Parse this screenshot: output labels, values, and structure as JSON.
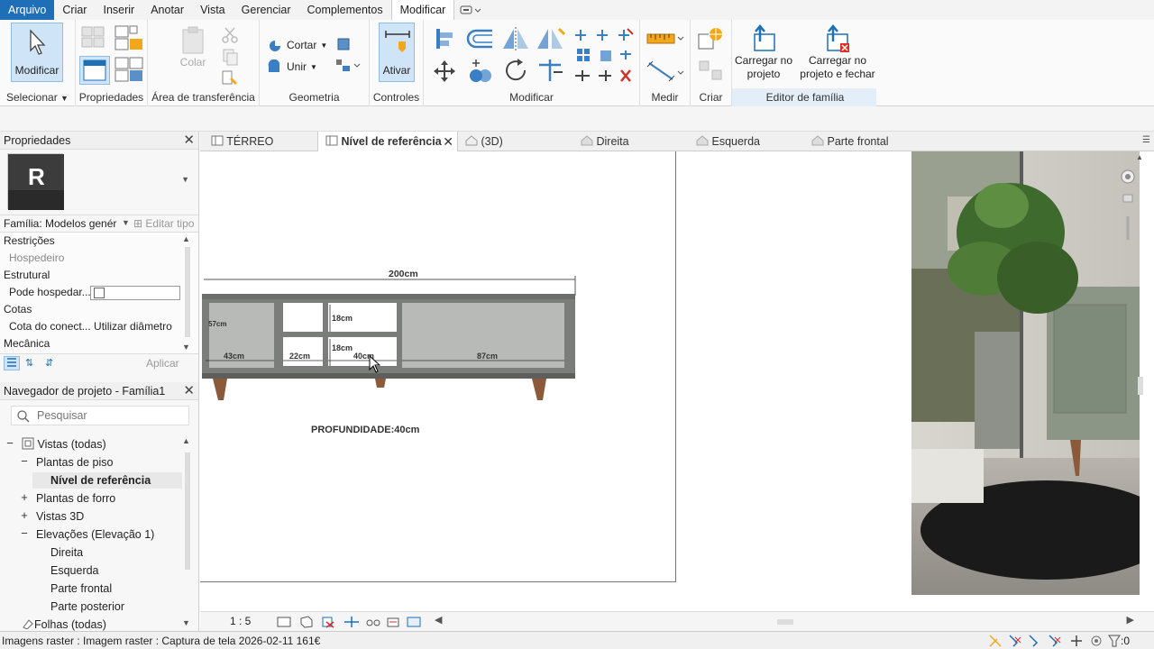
{
  "menu": {
    "items": [
      "Arquivo",
      "Criar",
      "Inserir",
      "Anotar",
      "Vista",
      "Gerenciar",
      "Complementos",
      "Modificar"
    ],
    "active": "Modificar"
  },
  "ribbon": {
    "modify_label": "Modificar",
    "select_label": "Selecionar",
    "properties_label": "Propriedades",
    "clipboard_label": "Área de transferência",
    "paste_label": "Colar",
    "cut_label": "Cortar",
    "join_label": "Unir",
    "geometry_label": "Geometria",
    "activate_label": "Ativar",
    "controls_label": "Controles",
    "modify_panel_label": "Modificar",
    "measure_label": "Medir",
    "create_label": "Criar",
    "load_project_line1": "Carregar no",
    "load_project_line2": "projeto",
    "load_close_line1": "Carregar no",
    "load_close_line2": "projeto e fechar",
    "family_editor_label": "Editor de família"
  },
  "properties": {
    "title": "Propriedades",
    "family_selector": "Família: Modelos genér",
    "edit_type": "Editar tipo",
    "rows": [
      {
        "kind": "cat",
        "label": "Restrições"
      },
      {
        "kind": "sub",
        "label": "Hospedeiro",
        "gray": true
      },
      {
        "kind": "cat",
        "label": "Estrutural"
      },
      {
        "kind": "sub",
        "label": "Pode hospedar..."
      },
      {
        "kind": "cat",
        "label": "Cotas"
      },
      {
        "kind": "sub",
        "label": "Cota do conect... Utilizar diâmetro"
      },
      {
        "kind": "cat",
        "label": "Mecânica"
      }
    ],
    "apply": "Aplicar"
  },
  "browser": {
    "title": "Navegador de projeto - Família1",
    "search_placeholder": "Pesquisar",
    "views_all": "Vistas (todas)",
    "floor_plans": "Plantas de piso",
    "ref_level": "Nível de referência",
    "ceiling_plans": "Plantas de forro",
    "views_3d": "Vistas 3D",
    "elevations": "Elevações (Elevação 1)",
    "right": "Direita",
    "left": "Esquerda",
    "front": "Parte frontal",
    "back": "Parte posterior",
    "sheets": "Folhas (todas)"
  },
  "tabs": {
    "terreo": "TÉRREO",
    "ref_level": "Nível de referência",
    "view3d": "(3D)",
    "right": "Direita",
    "left": "Esquerda",
    "front": "Parte frontal"
  },
  "drawing": {
    "width_dim": "200cm",
    "d57": "57cm",
    "d18a": "18cm",
    "d18b": "18cm",
    "d43": "43cm",
    "d22": "22cm",
    "d40": "40cm",
    "d87": "87cm",
    "depth": "PROFUNDIDADE:40cm"
  },
  "view": {
    "scale": "1 : 5"
  },
  "status": {
    "text": "Imagens raster : Imagem raster : Captura de tela 2026-02-11 161€",
    "filter_count": ":0"
  },
  "colors": {
    "accent": "#1e6fb7",
    "furniture": "#7a7d79",
    "wood": "#8a5a3a"
  }
}
